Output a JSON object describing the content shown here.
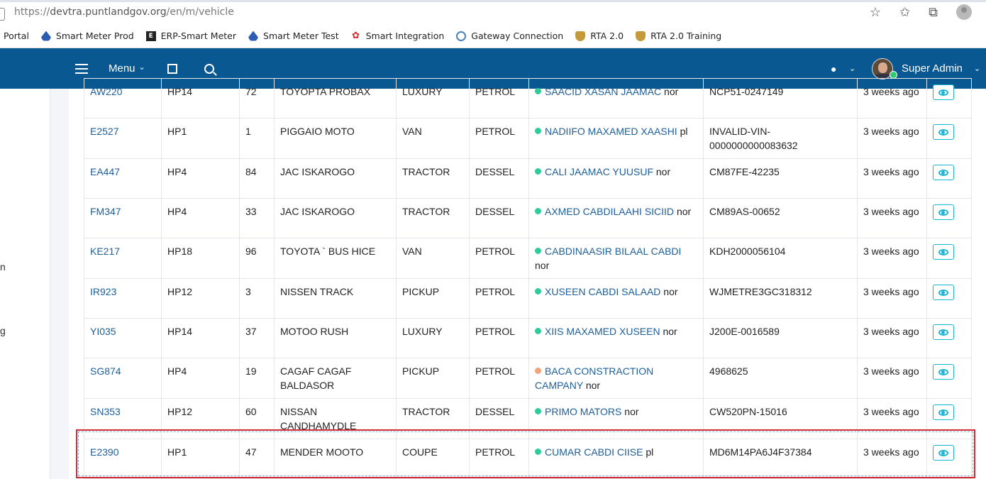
{
  "browser": {
    "url_prefix": "https://",
    "url_host": "devtra.puntlandgov.org",
    "url_path": "/en/m/vehicle",
    "icons": [
      "add-favorite-icon",
      "favorites-icon",
      "collections-icon",
      "profile-icon"
    ]
  },
  "bookmarks": [
    {
      "label": "Portal",
      "icon": "none"
    },
    {
      "label": "Smart Meter Prod",
      "icon": "drop-icon"
    },
    {
      "label": "ERP-Smart Meter",
      "icon": "erp-icon"
    },
    {
      "label": "Smart Meter Test",
      "icon": "drop-icon"
    },
    {
      "label": "Smart Integration",
      "icon": "huawei-icon"
    },
    {
      "label": "Gateway Connection",
      "icon": "gateway-icon"
    },
    {
      "label": "RTA 2.0",
      "icon": "crest-icon"
    },
    {
      "label": "RTA 2.0 Training",
      "icon": "crest-icon"
    }
  ],
  "topbar": {
    "menu_label": "Menu",
    "caret": "⌄",
    "user_name": "Super Admin",
    "colors": {
      "bar": "#0a5891",
      "online": "#2ecc71"
    }
  },
  "sidebar": {
    "fragments": [
      "n",
      "g"
    ]
  },
  "table": {
    "rows": [
      {
        "plate": "AW220",
        "hp": "HP14",
        "seats": "72",
        "model": "TOYOPTA PROBAX",
        "type": "LUXURY",
        "fuel": "PETROL",
        "owner": "SAACID XASAN JAAMAC",
        "owner_suffix": "nor",
        "owner_status": "#2ecc9a",
        "vin": "NCP51-0247149",
        "age": "3 weeks ago"
      },
      {
        "plate": "E2527",
        "hp": "HP1",
        "seats": "1",
        "model": "PIGGAIO MOTO",
        "type": "VAN",
        "fuel": "PETROL",
        "owner": "NADIIFO MAXAMED XAASHI",
        "owner_suffix": "pl",
        "owner_status": "#2ecc9a",
        "vin": "INVALID-VIN-0000000000083632",
        "age": "3 weeks ago"
      },
      {
        "plate": "EA447",
        "hp": "HP4",
        "seats": "84",
        "model": "JAC ISKAROGO",
        "type": "TRACTOR",
        "fuel": "DESSEL",
        "owner": "CALI JAAMAC YUUSUF",
        "owner_suffix": "nor",
        "owner_status": "#2ecc9a",
        "vin": "CM87FE-42235",
        "age": "3 weeks ago"
      },
      {
        "plate": "FM347",
        "hp": "HP4",
        "seats": "33",
        "model": "JAC ISKAROGO",
        "type": "TRACTOR",
        "fuel": "DESSEL",
        "owner": "AXMED CABDILAAHI SICIID",
        "owner_suffix": "nor",
        "owner_status": "#2ecc9a",
        "vin": "CM89AS-00652",
        "age": "3 weeks ago"
      },
      {
        "plate": "KE217",
        "hp": "HP18",
        "seats": "96",
        "model": "TOYOTA ` BUS HICE",
        "type": "VAN",
        "fuel": "PETROL",
        "owner": "CABDINAASIR BILAAL CABDI",
        "owner_suffix": "nor",
        "owner_status": "#2ecc9a",
        "vin": "KDH2000056104",
        "age": "3 weeks ago"
      },
      {
        "plate": "IR923",
        "hp": "HP12",
        "seats": "3",
        "model": "NISSEN TRACK",
        "type": "PICKUP",
        "fuel": "PETROL",
        "owner": "XUSEEN CABDI SALAAD",
        "owner_suffix": "nor",
        "owner_status": "#2ecc9a",
        "vin": "WJMETRE3GC318312",
        "age": "3 weeks ago"
      },
      {
        "plate": "YI035",
        "hp": "HP14",
        "seats": "37",
        "model": "MOTOO RUSH",
        "type": "LUXURY",
        "fuel": "PETROL",
        "owner": "XIIS MAXAMED XUSEEN",
        "owner_suffix": "nor",
        "owner_status": "#2ecc9a",
        "vin": "J200E-0016589",
        "age": "3 weeks ago"
      },
      {
        "plate": "SG874",
        "hp": "HP4",
        "seats": "19",
        "model": "CAGAF CAGAF BALDASOR",
        "type": "PICKUP",
        "fuel": "PETROL",
        "owner": "BACA CONSTRACTION CAMPANY",
        "owner_suffix": "nor",
        "owner_status": "#f4a27a",
        "vin": "4968625",
        "age": "3 weeks ago"
      },
      {
        "plate": "SN353",
        "hp": "HP12",
        "seats": "60",
        "model": "NISSAN CANDHAMYDLE",
        "type": "TRACTOR",
        "fuel": "DESSEL",
        "owner": "PRIMO MATORS",
        "owner_suffix": "nor",
        "owner_status": "#2ecc9a",
        "vin": "CW520PN-15016",
        "age": "3 weeks ago"
      },
      {
        "plate": "E2390",
        "hp": "HP1",
        "seats": "47",
        "model": "MENDER MOOTO",
        "type": "COUPE",
        "fuel": "PETROL",
        "owner": "CUMAR CABDI CIISE",
        "owner_suffix": "pl",
        "owner_status": "#2ecc9a",
        "vin": "MD6M14PA6J4F37384",
        "age": "3 weeks ago"
      }
    ],
    "action_icon": "eye-icon",
    "accent": "#18b4d6",
    "link_color": "#1d5e9a",
    "selection_color": "#d02b3a"
  }
}
